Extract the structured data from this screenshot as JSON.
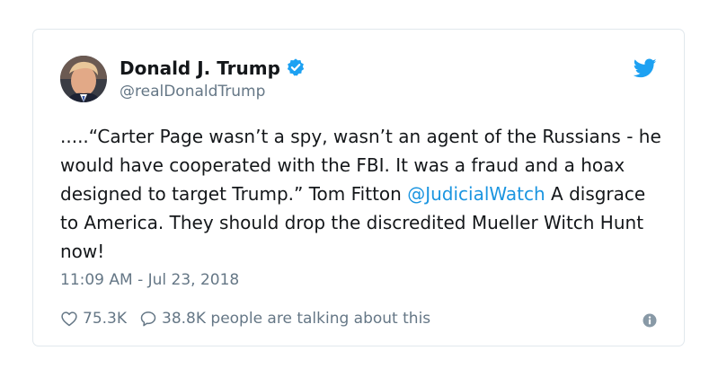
{
  "author": {
    "name": "Donald J. Trump",
    "handle": "@realDonaldTrump",
    "verified": true,
    "avatar_icon": "profile-photo"
  },
  "tweet": {
    "text_before": ".....“Carter Page wasn’t a spy, wasn’t an agent of the Russians - he would have cooperated with the FBI. It was a fraud and a hoax designed to target Trump.” Tom Fitton ",
    "mention": "@JudicialWatch",
    "text_after": " A disgrace to America. They should drop the discredited Mueller Witch Hunt now!",
    "timestamp": "11:09 AM - Jul 23, 2018"
  },
  "stats": {
    "likes": "75.3K",
    "replies": "38.8K people are talking about this"
  },
  "icons": {
    "brand": "twitter-bird-icon",
    "verified": "verified-badge-icon",
    "like": "heart-icon",
    "reply": "speech-bubble-icon",
    "info": "info-icon"
  },
  "colors": {
    "twitter_blue": "#1da1f2",
    "link": "#1b95e0",
    "secondary_text": "#657786",
    "border": "#e1e8ed"
  }
}
